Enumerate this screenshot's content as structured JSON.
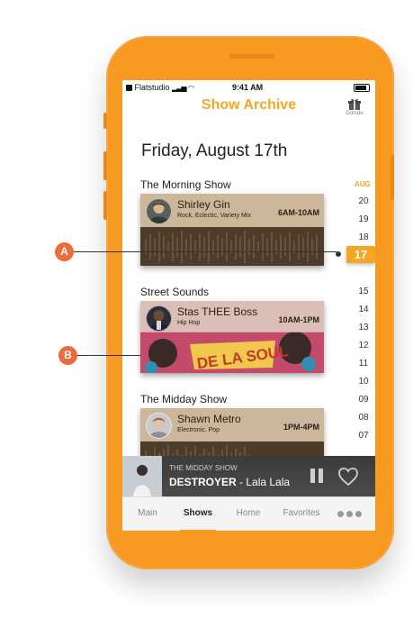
{
  "status_bar": {
    "carrier": "Flatstudio",
    "time": "9:41 AM"
  },
  "header": {
    "title": "Show Archive",
    "donate_label": "Donate"
  },
  "date_heading": "Friday, August 17th",
  "shows": [
    {
      "title": "The Morning Show",
      "host": "Shirley Gin",
      "genres": "Rock, Eclectic, Variety Mix",
      "airtime": "6AM-10AM"
    },
    {
      "title": "Street Sounds",
      "host": "Stas THEE Boss",
      "genres": "Hip Hop",
      "airtime": "10AM-1PM"
    },
    {
      "title": "The Midday Show",
      "host": "Shawn Metro",
      "genres": "Electronic, Pop",
      "airtime": "1PM-4PM"
    }
  ],
  "date_picker": {
    "month": "AUG",
    "dates_before": [
      "20",
      "19",
      "18"
    ],
    "selected": "17",
    "dates_after": [
      "15",
      "14",
      "13",
      "12",
      "11",
      "10",
      "09",
      "08",
      "07"
    ]
  },
  "now_playing": {
    "show": "THE MIDDAY SHOW",
    "track": "DESTROYER",
    "separator": " - ",
    "artist": "Lala Lala"
  },
  "tabs": [
    "Main",
    "Shows",
    "Home",
    "Favorites"
  ],
  "active_tab": "Shows",
  "callouts": [
    "A",
    "B"
  ],
  "colors": {
    "accent": "#f5a623",
    "phone_body": "#f89a22",
    "callout": "#ef6a3a"
  }
}
